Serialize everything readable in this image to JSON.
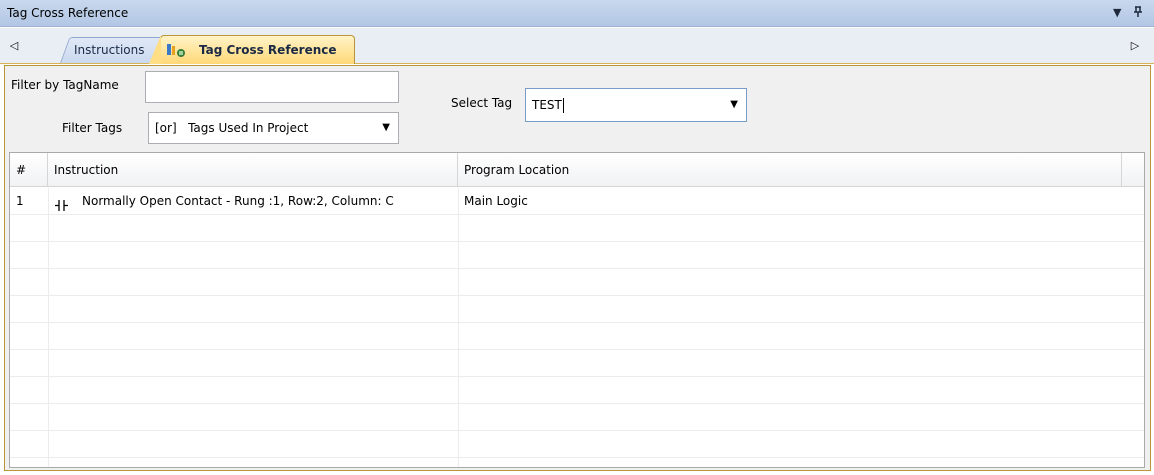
{
  "window": {
    "title": "Tag Cross Reference",
    "dropdown_glyph": "▼",
    "pin_glyph": "⊥"
  },
  "tabs": {
    "scroll_left": "◁",
    "scroll_right": "▷",
    "items": [
      {
        "label": "Instructions",
        "active": false
      },
      {
        "label": "Tag Cross Reference",
        "active": true,
        "icon": "tag-cross-reference-icon"
      }
    ]
  },
  "filters": {
    "filter_by_tagname_label": "Filter by TagName",
    "filter_by_tagname_value": "",
    "filter_tags_label": "Filter Tags",
    "filter_tags_value": "[or]   Tags Used In Project",
    "select_tag_label": "Select Tag",
    "select_tag_value": "TEST"
  },
  "grid": {
    "columns": [
      "#",
      "Instruction",
      "Program Location"
    ],
    "rows": [
      {
        "num": "1",
        "instruction_icon": "normally-open-contact-icon",
        "instruction": "Normally Open Contact - Rung :1, Row:2, Column: C",
        "location": "Main Logic"
      }
    ]
  },
  "colors": {
    "title_bar": "#b8cbe6",
    "active_tab": "#ffd877",
    "tab_border": "#b9963a",
    "panel_bg": "#f0f0f0"
  }
}
